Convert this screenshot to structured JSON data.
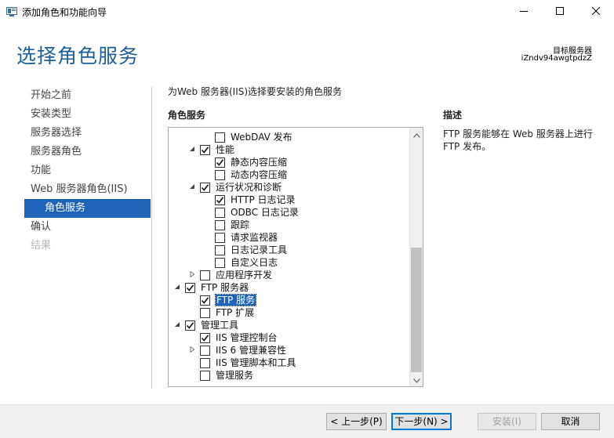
{
  "window": {
    "title": "添加角色和功能向导"
  },
  "header": {
    "page_title": "选择角色服务",
    "target_label": "目标服务器",
    "target_server": "iZndv94awgtpdzZ"
  },
  "nav": {
    "items": [
      {
        "label": "开始之前",
        "state": "normal"
      },
      {
        "label": "安装类型",
        "state": "normal"
      },
      {
        "label": "服务器选择",
        "state": "normal"
      },
      {
        "label": "服务器角色",
        "state": "normal"
      },
      {
        "label": "功能",
        "state": "normal"
      },
      {
        "label": "Web 服务器角色(IIS)",
        "state": "normal"
      },
      {
        "label": "角色服务",
        "state": "active"
      },
      {
        "label": "确认",
        "state": "normal"
      },
      {
        "label": "结果",
        "state": "disabled"
      }
    ]
  },
  "main": {
    "instruction": "为Web 服务器(IIS)选择要安装的角色服务",
    "role_services_header": "角色服务",
    "description_header": "描述",
    "description_text": "FTP 服务能够在 Web 服务器上进行 FTP 发布。"
  },
  "tree": {
    "items": [
      {
        "label": "WebDAV 发布",
        "checked": false,
        "expander": "none"
      },
      {
        "label": "性能",
        "checked": true,
        "expander": "expanded"
      },
      {
        "label": "静态内容压缩",
        "checked": true,
        "expander": "none"
      },
      {
        "label": "动态内容压缩",
        "checked": false,
        "expander": "none"
      },
      {
        "label": "运行状况和诊断",
        "checked": true,
        "expander": "expanded"
      },
      {
        "label": "HTTP 日志记录",
        "checked": true,
        "expander": "none"
      },
      {
        "label": "ODBC 日志记录",
        "checked": false,
        "expander": "none"
      },
      {
        "label": "跟踪",
        "checked": false,
        "expander": "none"
      },
      {
        "label": "请求监视器",
        "checked": false,
        "expander": "none"
      },
      {
        "label": "日志记录工具",
        "checked": false,
        "expander": "none"
      },
      {
        "label": "自定义日志",
        "checked": false,
        "expander": "none"
      },
      {
        "label": "应用程序开发",
        "checked": false,
        "expander": "collapsed"
      },
      {
        "label": "FTP 服务器",
        "checked": true,
        "expander": "expanded"
      },
      {
        "label": "FTP 服务",
        "checked": true,
        "expander": "none",
        "selected": true
      },
      {
        "label": "FTP 扩展",
        "checked": false,
        "expander": "none"
      },
      {
        "label": "管理工具",
        "checked": true,
        "expander": "expanded"
      },
      {
        "label": "IIS 管理控制台",
        "checked": true,
        "expander": "none"
      },
      {
        "label": "IIS 6 管理兼容性",
        "checked": false,
        "expander": "collapsed"
      },
      {
        "label": "IIS 管理脚本和工具",
        "checked": false,
        "expander": "none"
      },
      {
        "label": "管理服务",
        "checked": false,
        "expander": "none"
      }
    ]
  },
  "footer": {
    "prev_label": "< 上一步(P)",
    "next_label": "下一步(N) >",
    "install_label": "安装(I)",
    "cancel_label": "取消"
  },
  "colors": {
    "title_blue": "#1f5f93",
    "selection_blue": "#1f64b8",
    "default_button_border": "#0078d7"
  }
}
